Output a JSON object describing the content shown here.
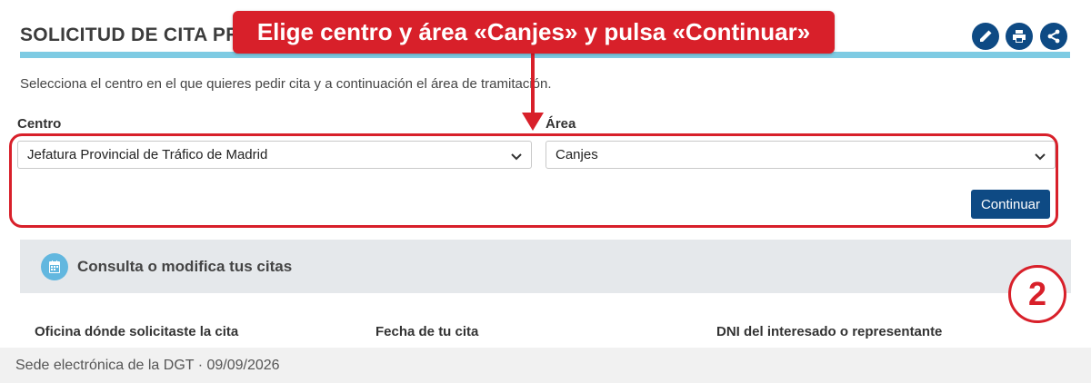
{
  "header": {
    "title": "SOLICITUD DE CITA PR",
    "actions": [
      {
        "name": "edit",
        "icon": "pencil-icon"
      },
      {
        "name": "print",
        "icon": "printer-icon"
      },
      {
        "name": "share",
        "icon": "share-icon"
      }
    ]
  },
  "callout": {
    "text": "Elige centro y área «Canjes» y pulsa «Continuar»",
    "color": "#d8202a"
  },
  "intro": "Selecciona el centro en el que quieres pedir cita y a continuación el área de tramitación.",
  "form": {
    "centro_label": "Centro",
    "centro_value": "Jefatura Provincial de Tráfico de Madrid",
    "area_label": "Área",
    "area_value": "Canjes",
    "continue_label": "Continuar"
  },
  "accordion": {
    "icon": "calendar-icon",
    "title": "Consulta o modifica tus citas"
  },
  "step_badge": "2",
  "columns": [
    "Oficina dónde solicitaste la cita",
    "Fecha de tu cita",
    "DNI del interesado o representante"
  ],
  "footer": "Sede electrónica de la DGT · 09/09/2026",
  "colors": {
    "primary": "#0e4a84",
    "accent_rule": "#7ecbe3",
    "annotation": "#d8202a"
  }
}
